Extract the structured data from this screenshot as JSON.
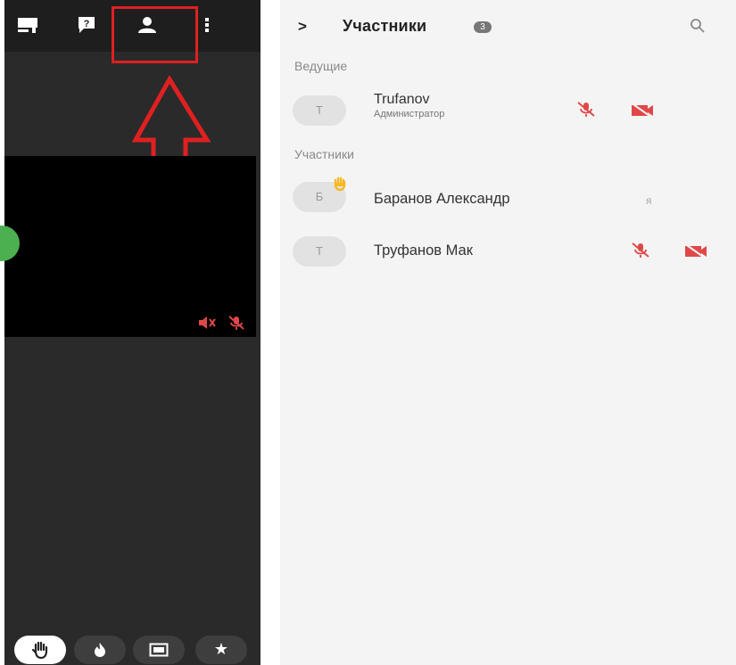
{
  "left_toolbar": {
    "buttons": [
      {
        "name": "chat",
        "icon": "chat-icon"
      },
      {
        "name": "question",
        "icon": "question-icon",
        "label": "?"
      },
      {
        "name": "participants",
        "icon": "person-icon"
      },
      {
        "name": "more",
        "icon": "more-vertical-icon"
      }
    ]
  },
  "bottom_toolbar": {
    "buttons": [
      {
        "name": "raise-hand",
        "icon": "hand-icon",
        "active": true
      },
      {
        "name": "reactions",
        "icon": "fire-icon"
      },
      {
        "name": "screen",
        "icon": "screen-icon"
      },
      {
        "name": "favorites",
        "icon": "star-icon",
        "label": "★"
      }
    ]
  },
  "panel": {
    "chevron": ">",
    "title": "Участники",
    "count": "3",
    "search_icon": "search-icon"
  },
  "sections": {
    "hosts_label": "Ведущие",
    "participants_label": "Участники"
  },
  "participants": [
    {
      "initial": "Т",
      "name": "Trufanov",
      "role": "Администратор",
      "mic_muted": true,
      "cam_off": true
    },
    {
      "initial": "Б",
      "name": "Баранов Александр",
      "me_label": "я",
      "hand_raised": true
    },
    {
      "initial": "Т",
      "name": "Труфанов Мак",
      "mic_muted": true,
      "cam_off": true
    }
  ],
  "colors": {
    "muted_red": "#e04848",
    "highlight_red": "#e02020",
    "hand_yellow": "#f5b921",
    "avatar_green": "#4caf50"
  }
}
